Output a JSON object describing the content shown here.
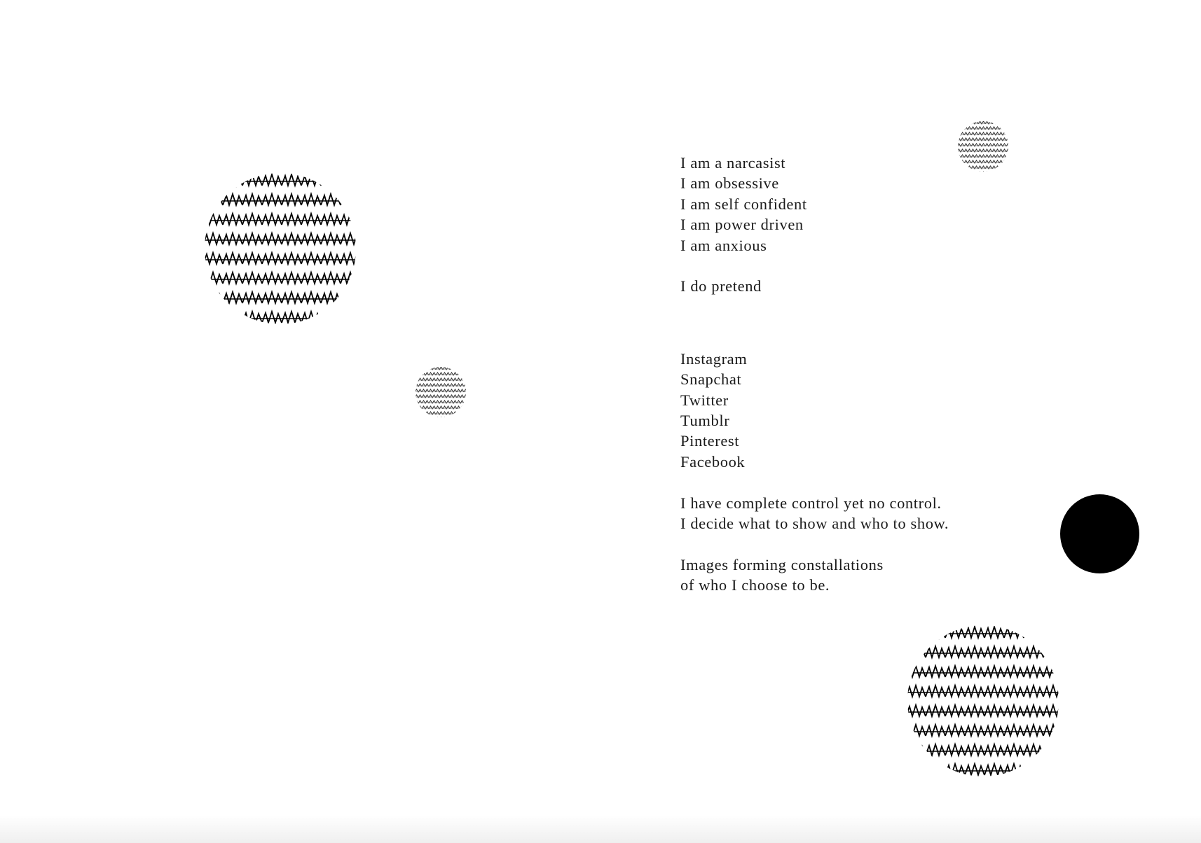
{
  "colors": {
    "background": "#ffffff",
    "ink": "#1a1a1a",
    "solid_dot": "#000000"
  },
  "decorations": {
    "large_dot_pattern": "zigzag-stripes",
    "small_dot_pattern": "fine-zigzag-stripes",
    "solid_dot": "black-circle"
  },
  "poem": {
    "stanza1": [
      "I am a narcasist",
      "I am obsessive",
      "I am self confident",
      "I am power driven",
      "I am anxious"
    ],
    "stanza2": [
      "I do pretend"
    ],
    "stanza3": [
      "Instagram",
      "Snapchat",
      "Twitter",
      "Tumblr",
      "Pinterest",
      "Facebook"
    ],
    "stanza4": [
      "I have complete control yet no control.",
      "I decide what to show and who to show."
    ],
    "stanza5": [
      "Images forming constallations",
      "of who I choose to be."
    ]
  }
}
